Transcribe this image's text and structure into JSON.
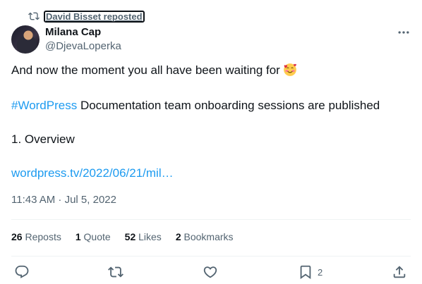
{
  "repost": {
    "text": "David Bisset reposted",
    "icon": "repost-icon"
  },
  "author": {
    "name": "Milana Cap",
    "handle": "@DjevaLoperka"
  },
  "tweet": {
    "line1": "And now the moment you all have been waiting for",
    "line1_emoji": "smiling-face-with-hearts",
    "hashtag": "#WordPress",
    "line2_rest": " Documentation team onboarding sessions are published",
    "line3": "1. Overview",
    "link": "wordpress.tv/2022/06/21/mil…"
  },
  "timestamp": "11:43 AM · Jul 5, 2022",
  "stats": {
    "reposts_count": "26",
    "reposts_label": "Reposts",
    "quotes_count": "1",
    "quotes_label": "Quote",
    "likes_count": "52",
    "likes_label": "Likes",
    "bookmarks_count": "2",
    "bookmarks_label": "Bookmarks"
  },
  "actions": {
    "bookmark_count": "2"
  },
  "colors": {
    "link": "#1d9bf0",
    "muted": "#536471",
    "text": "#0f1419",
    "divider": "#eff3f4"
  }
}
